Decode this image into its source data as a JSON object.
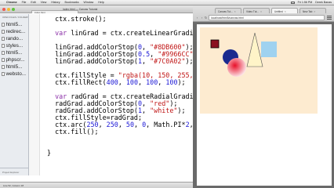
{
  "menubar": {
    "app": "Chrome",
    "items": [
      "File",
      "Edit",
      "View",
      "History",
      "Bookmarks",
      "Window",
      "Help"
    ],
    "clock": "Fri 1:56 PM",
    "user": "Derek Banas"
  },
  "editor": {
    "title": "index.html — Canvas Tutorial",
    "tab_label": "index.html",
    "sidebar_header": "OPEN FILES / FOLDERS",
    "files": [
      "html5...",
      "redirec...",
      "rando...",
      "styles...",
      "html5...",
      "phpscr...",
      "html5...",
      "websto..."
    ],
    "sidebar_footer": "Project Explorer",
    "status": "Line 52, Column 18",
    "code_lines": [
      {
        "indent": "  ",
        "parts": [
          {
            "t": "ctx.stroke();",
            "c": ""
          }
        ]
      },
      {
        "indent": "",
        "parts": []
      },
      {
        "indent": "  ",
        "parts": [
          {
            "t": "var",
            "c": "kw"
          },
          {
            "t": " linGrad = ctx.createLinearGradien",
            "c": ""
          }
        ]
      },
      {
        "indent": "",
        "parts": []
      },
      {
        "indent": "  ",
        "parts": [
          {
            "t": "linGrad.addColorStop(",
            "c": ""
          },
          {
            "t": "0",
            "c": "num"
          },
          {
            "t": ", ",
            "c": ""
          },
          {
            "t": "\"#8DB600\"",
            "c": "str"
          },
          {
            "t": ");",
            "c": ""
          }
        ]
      },
      {
        "indent": "  ",
        "parts": [
          {
            "t": "linGrad.addColorStop(",
            "c": ""
          },
          {
            "t": "0.5",
            "c": "num"
          },
          {
            "t": ", ",
            "c": ""
          },
          {
            "t": "\"#9966CC\"",
            "c": "str"
          },
          {
            "t": ");",
            "c": ""
          }
        ]
      },
      {
        "indent": "  ",
        "parts": [
          {
            "t": "linGrad.addColorStop(",
            "c": ""
          },
          {
            "t": "1",
            "c": "num"
          },
          {
            "t": ", ",
            "c": ""
          },
          {
            "t": "\"#7C0A02\"",
            "c": "str"
          },
          {
            "t": ");",
            "c": ""
          }
        ]
      },
      {
        "indent": "",
        "parts": []
      },
      {
        "indent": "  ",
        "parts": [
          {
            "t": "ctx.fillStyle = ",
            "c": ""
          },
          {
            "t": "\"rgba(10, 150, 255, 0.",
            "c": "str"
          }
        ]
      },
      {
        "indent": "  ",
        "parts": [
          {
            "t": "ctx.fillRect(",
            "c": ""
          },
          {
            "t": "400",
            "c": "num"
          },
          {
            "t": ", ",
            "c": ""
          },
          {
            "t": "100",
            "c": "num"
          },
          {
            "t": ", ",
            "c": ""
          },
          {
            "t": "100",
            "c": "num"
          },
          {
            "t": ", ",
            "c": ""
          },
          {
            "t": "100",
            "c": "num"
          },
          {
            "t": ");",
            "c": ""
          }
        ]
      },
      {
        "indent": "",
        "parts": []
      },
      {
        "indent": "  ",
        "parts": [
          {
            "t": "var",
            "c": "kw"
          },
          {
            "t": " radGrad = ctx.createRadialGradien",
            "c": ""
          }
        ]
      },
      {
        "indent": "  ",
        "parts": [
          {
            "t": "radGrad.addColorStop(",
            "c": ""
          },
          {
            "t": "0",
            "c": "num"
          },
          {
            "t": ", ",
            "c": ""
          },
          {
            "t": "\"red\"",
            "c": "str"
          },
          {
            "t": ");",
            "c": ""
          }
        ]
      },
      {
        "indent": "  ",
        "parts": [
          {
            "t": "radGrad.addColorStop(",
            "c": ""
          },
          {
            "t": "1",
            "c": "num"
          },
          {
            "t": ", ",
            "c": ""
          },
          {
            "t": "\"white\"",
            "c": "str"
          },
          {
            "t": ");",
            "c": ""
          }
        ]
      },
      {
        "indent": "  ",
        "parts": [
          {
            "t": "ctx.fillStyle=radGrad;",
            "c": ""
          }
        ]
      },
      {
        "indent": "  ",
        "parts": [
          {
            "t": "ctx.arc(",
            "c": ""
          },
          {
            "t": "250",
            "c": "num"
          },
          {
            "t": ", ",
            "c": ""
          },
          {
            "t": "250",
            "c": "num"
          },
          {
            "t": ", ",
            "c": ""
          },
          {
            "t": "50",
            "c": "num"
          },
          {
            "t": ", ",
            "c": ""
          },
          {
            "t": "0",
            "c": "num"
          },
          {
            "t": ", Math.PI*",
            "c": ""
          },
          {
            "t": "2",
            "c": "num"
          },
          {
            "t": ", t",
            "c": ""
          }
        ]
      },
      {
        "indent": "  ",
        "parts": [
          {
            "t": "ctx.fill();",
            "c": ""
          }
        ]
      },
      {
        "indent": "",
        "parts": []
      },
      {
        "indent": "",
        "parts": []
      },
      {
        "indent": "}",
        "parts": []
      }
    ]
  },
  "browser": {
    "tabs": [
      {
        "label": "Canvas Tut...",
        "active": false
      },
      {
        "label": "Video Tut...",
        "active": false
      },
      {
        "label": "Untitled",
        "active": true
      },
      {
        "label": "New Tab",
        "active": false
      }
    ],
    "url": "localhost/html5/canvas.html",
    "colors": {
      "canvas_bg": "#fdebd0",
      "dark_red_square": "#8b1020",
      "blue_circle": "#1a2a8f",
      "light_blue_square": "#9fd2f0",
      "triangle_fill": "#fff4c8",
      "radial_center": "#e8102a"
    }
  }
}
